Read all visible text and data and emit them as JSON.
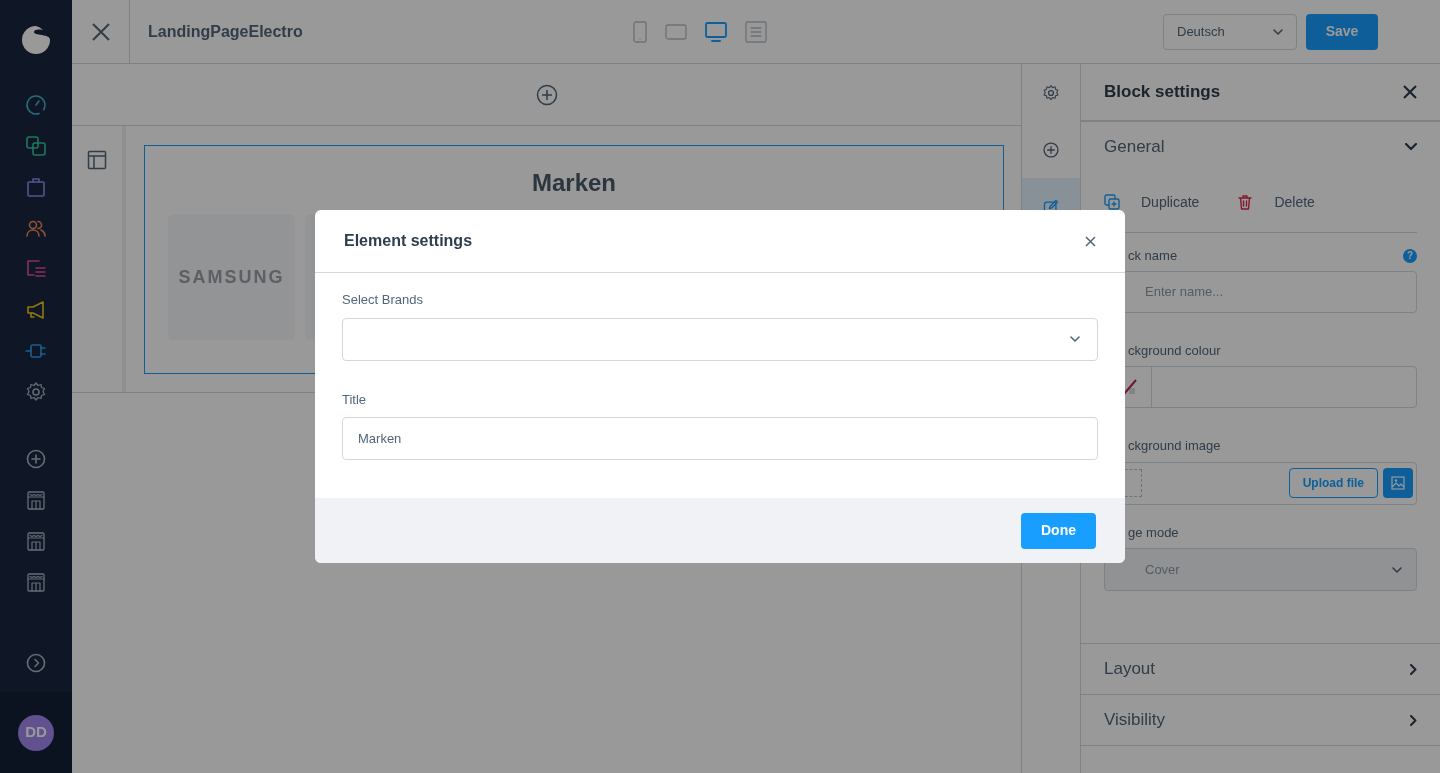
{
  "sidebar": {
    "nav_items": [
      {
        "kind": "gauge"
      },
      {
        "kind": "squares"
      },
      {
        "kind": "bag"
      },
      {
        "kind": "people"
      },
      {
        "kind": "list"
      },
      {
        "kind": "megaphone"
      },
      {
        "kind": "plug"
      },
      {
        "kind": "gear"
      }
    ],
    "extra_items": [
      {
        "kind": "plus"
      },
      {
        "kind": "store"
      },
      {
        "kind": "store"
      },
      {
        "kind": "store"
      },
      {
        "kind": "expand"
      }
    ],
    "avatar": {
      "initials": "DD"
    }
  },
  "topbar": {
    "title": "LandingPageElectro",
    "devices": [
      {
        "kind": "mobile",
        "selected": false
      },
      {
        "kind": "tablet",
        "selected": false
      },
      {
        "kind": "desktop",
        "selected": true
      },
      {
        "kind": "list",
        "selected": false
      }
    ],
    "language": "Deutsch",
    "save": "Save"
  },
  "canvas": {
    "block_title": "Marken",
    "brand_tiles": [
      "SAMSUNG"
    ]
  },
  "right_toolbar": [
    {
      "kind": "gear",
      "selected": false
    },
    {
      "kind": "plus",
      "selected": false
    },
    {
      "kind": "edit",
      "selected": true
    }
  ],
  "block_settings": {
    "title": "Block settings",
    "general": {
      "label": "General",
      "expanded": true
    },
    "actions": [
      {
        "kind": "duplicate",
        "label": "Duplicate"
      },
      {
        "kind": "delete",
        "label": "Delete"
      }
    ],
    "block_name_label": "ck name",
    "help_icon": "?",
    "block_name_placeholder": "Enter name...",
    "background_colour_label": "ckground colour",
    "background_image_label": "ckground image",
    "upload_button": "Upload file",
    "image_mode_label": "ge mode",
    "image_mode_value": "Cover",
    "sections": [
      {
        "label": "Layout",
        "expanded": false
      },
      {
        "label": "Visibility",
        "expanded": false
      }
    ]
  },
  "modal": {
    "title": "Element settings",
    "fields": [
      {
        "kind": "select",
        "label": "Select Brands"
      },
      {
        "kind": "text",
        "label": "Title",
        "value": "Marken"
      }
    ],
    "button": "Done"
  }
}
